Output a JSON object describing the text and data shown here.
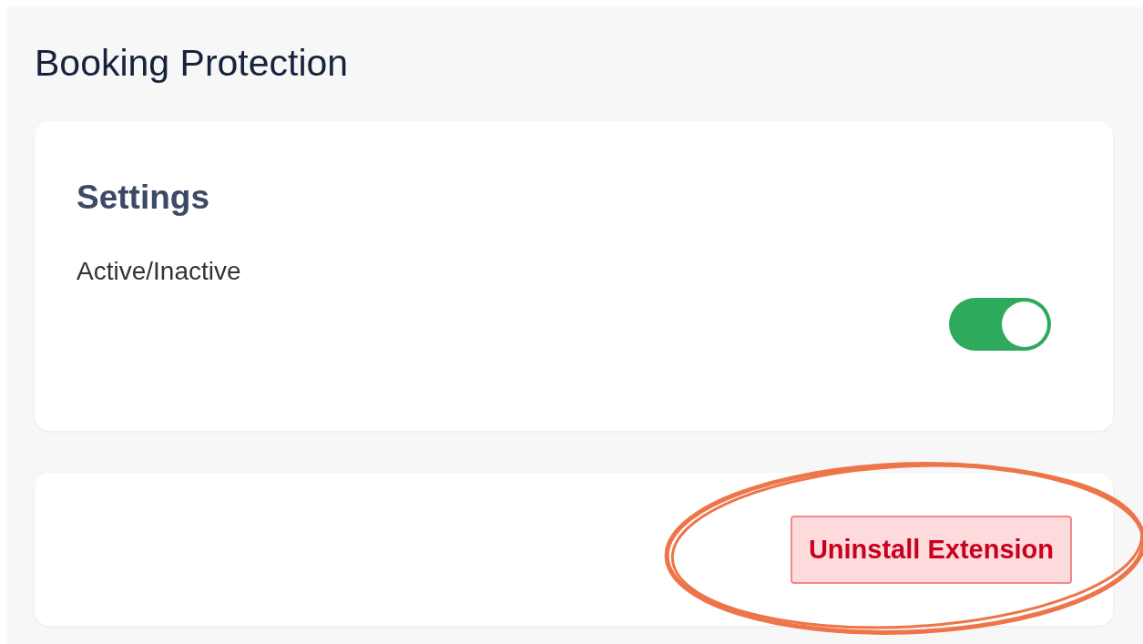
{
  "page": {
    "title": "Booking Protection"
  },
  "settings_card": {
    "heading": "Settings",
    "toggle": {
      "label": "Active/Inactive",
      "on": true
    }
  },
  "actions_card": {
    "button": "Uninstall Extension",
    "annotation": {
      "kind": "ellipse"
    }
  }
}
